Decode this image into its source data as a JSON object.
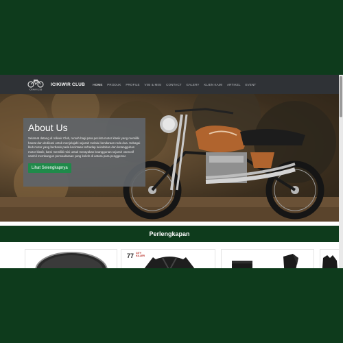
{
  "navbar": {
    "brand": "ICIKIWIR CLUB",
    "logo_caption": "ICIKIWIR CLUB",
    "items": [
      {
        "label": "HOME",
        "active": true
      },
      {
        "label": "PRODUK",
        "active": false
      },
      {
        "label": "PROFILE",
        "active": false
      },
      {
        "label": "VISI & MISI",
        "active": false
      },
      {
        "label": "CONTACT",
        "active": false
      },
      {
        "label": "GALERY",
        "active": false
      },
      {
        "label": "KLIEN KAMI",
        "active": false
      },
      {
        "label": "ARTIKEL",
        "active": false
      },
      {
        "label": "EVENT",
        "active": false
      }
    ]
  },
  "hero": {
    "title": "About Us",
    "body": "Selamat datang di Icikiwir Club, rumah bagi para pecinta motor klasik yang memiliki hasrat dan dedikasi untuk menjelajahi sejarah melalui kendaraan roda dua. Sebagai klub motor yang berbasis pada kecintaan terhadap keindahan dan ketangguhan motor klasik, kami memiliki misi untuk merayakan keanggunan sejarah otomotif sambil membangun persaudaraan yang kokoh di antara para penggemar.",
    "button_label": "Lihat Selengkapnya"
  },
  "section": {
    "title": "Perlengkapan"
  },
  "products": [
    {
      "icon": "helmet-icon"
    },
    {
      "icon": "jacket-icon",
      "badge_number": "77",
      "badge_text_line1": "CITY",
      "badge_text_line2": "KILLER"
    },
    {
      "icon": "boots-icon"
    },
    {
      "icon": "gloves-icon"
    }
  ],
  "colors": {
    "page_bg": "#0e3b1c",
    "navbar_bg": "#2f3236",
    "section_bar_bg": "#0e3b1c",
    "button_bg": "#1f8a4a",
    "about_panel_bg": "#606468"
  }
}
